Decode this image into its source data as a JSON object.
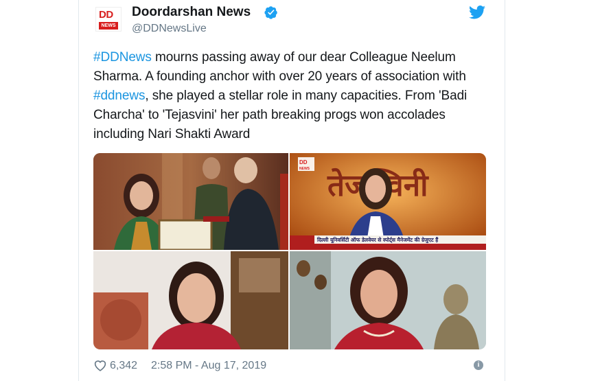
{
  "account": {
    "name": "Doordarshan News",
    "handle": "@DDNewsLive",
    "avatar_dd": "DD",
    "avatar_news": "NEWS"
  },
  "tweet": {
    "segments": [
      {
        "text": "#DDNews",
        "hashtag": true
      },
      {
        "text": " mourns passing away of our dear Colleague Neelum Sharma. A founding anchor with over 20 years of association with ",
        "hashtag": false
      },
      {
        "text": "#ddnews",
        "hashtag": true
      },
      {
        "text": ", she played a stellar role in many capacities. From 'Badi Charcha' to 'Tejasvini' her path breaking progs won accolades including Nari Shakti Award",
        "hashtag": false
      }
    ]
  },
  "media": {
    "photos": [
      {
        "name": "photo-award-ceremony",
        "caption": ""
      },
      {
        "name": "photo-tejasvini-show",
        "title_text": "तेजस्विनी",
        "ticker_text": "दिल्ली यूनिवर्सिटी ऑफ डेलवेयर से स्पोर्ट्स मैनेजमेंट की ग्रेजुएट हैं",
        "logo_dd": "DD",
        "logo_news": "NEWS"
      },
      {
        "name": "photo-portrait-home"
      },
      {
        "name": "photo-portrait-buddha"
      }
    ]
  },
  "footer": {
    "likes": "6,342",
    "timestamp": "2:58 PM - Aug 17, 2019",
    "info_icon": "i"
  },
  "colors": {
    "hashtag": "#1b95e0",
    "verified": "#1da1f2",
    "twitter_logo": "#1da1f2",
    "secondary_text": "#657786",
    "brand_red": "#d81e1e"
  }
}
